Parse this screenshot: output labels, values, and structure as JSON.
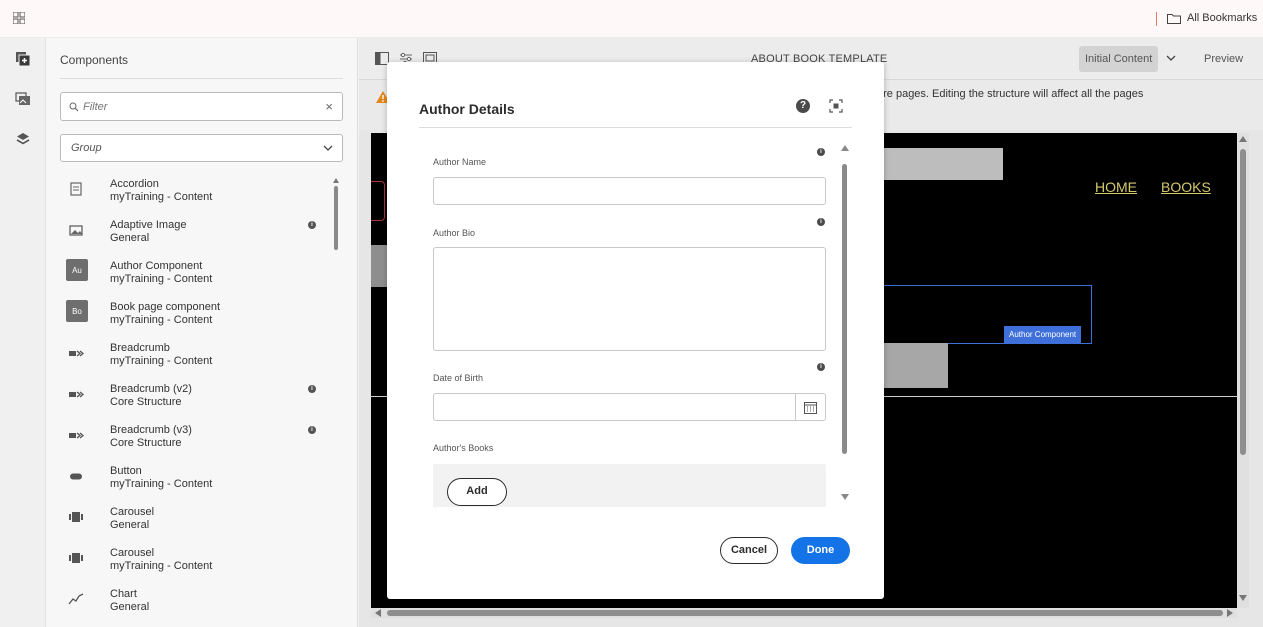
{
  "topbar": {
    "bookmarks_label": "All Bookmarks",
    "icons": [
      "apps-grid-icon",
      "folder-icon"
    ]
  },
  "rail": {
    "icons": [
      "components-icon",
      "assets-icon",
      "layers-icon"
    ]
  },
  "components_panel": {
    "title": "Components",
    "filter": {
      "placeholder": "Filter",
      "value": ""
    },
    "group_select": {
      "value": "Group"
    },
    "items": [
      {
        "name": "Accordion",
        "group": "myTraining - Content",
        "icon": "accordion-icon",
        "info": false
      },
      {
        "name": "Adaptive Image",
        "group": "General",
        "icon": "image-icon",
        "info": true
      },
      {
        "name": "Author Component",
        "group": "myTraining - Content",
        "badge": "Au",
        "info": false
      },
      {
        "name": "Book page component",
        "group": "myTraining - Content",
        "badge": "Bo",
        "info": false
      },
      {
        "name": "Breadcrumb",
        "group": "myTraining - Content",
        "icon": "breadcrumb-icon",
        "info": false
      },
      {
        "name": "Breadcrumb (v2)",
        "group": "Core Structure",
        "icon": "breadcrumb-icon",
        "info": true
      },
      {
        "name": "Breadcrumb (v3)",
        "group": "Core Structure",
        "icon": "breadcrumb-icon",
        "info": true
      },
      {
        "name": "Button",
        "group": "myTraining - Content",
        "icon": "button-icon",
        "info": false
      },
      {
        "name": "Carousel",
        "group": "General",
        "icon": "carousel-icon",
        "info": false
      },
      {
        "name": "Carousel",
        "group": "myTraining - Content",
        "icon": "carousel-icon",
        "info": false
      },
      {
        "name": "Chart",
        "group": "General",
        "icon": "chart-icon",
        "info": false
      }
    ]
  },
  "editor": {
    "title": "ABOUT BOOK TEMPLATE",
    "mode_select": "Initial Content",
    "preview_label": "Preview",
    "warning_text": "ore pages. Editing the structure will affect all the pages",
    "canvas": {
      "nav_home": "HOME",
      "nav_books": "BOOKS",
      "component_label": "Author Component"
    }
  },
  "dialog": {
    "title": "Author Details",
    "fields": {
      "author_name": {
        "label": "Author Name",
        "value": ""
      },
      "author_bio": {
        "label": "Author Bio",
        "value": ""
      },
      "date_of_birth": {
        "label": "Date of Birth",
        "value": ""
      },
      "authors_books": {
        "label": "Author's Books",
        "add_label": "Add"
      }
    },
    "cancel_label": "Cancel",
    "done_label": "Done",
    "colors": {
      "primary": "#1473e6"
    }
  }
}
